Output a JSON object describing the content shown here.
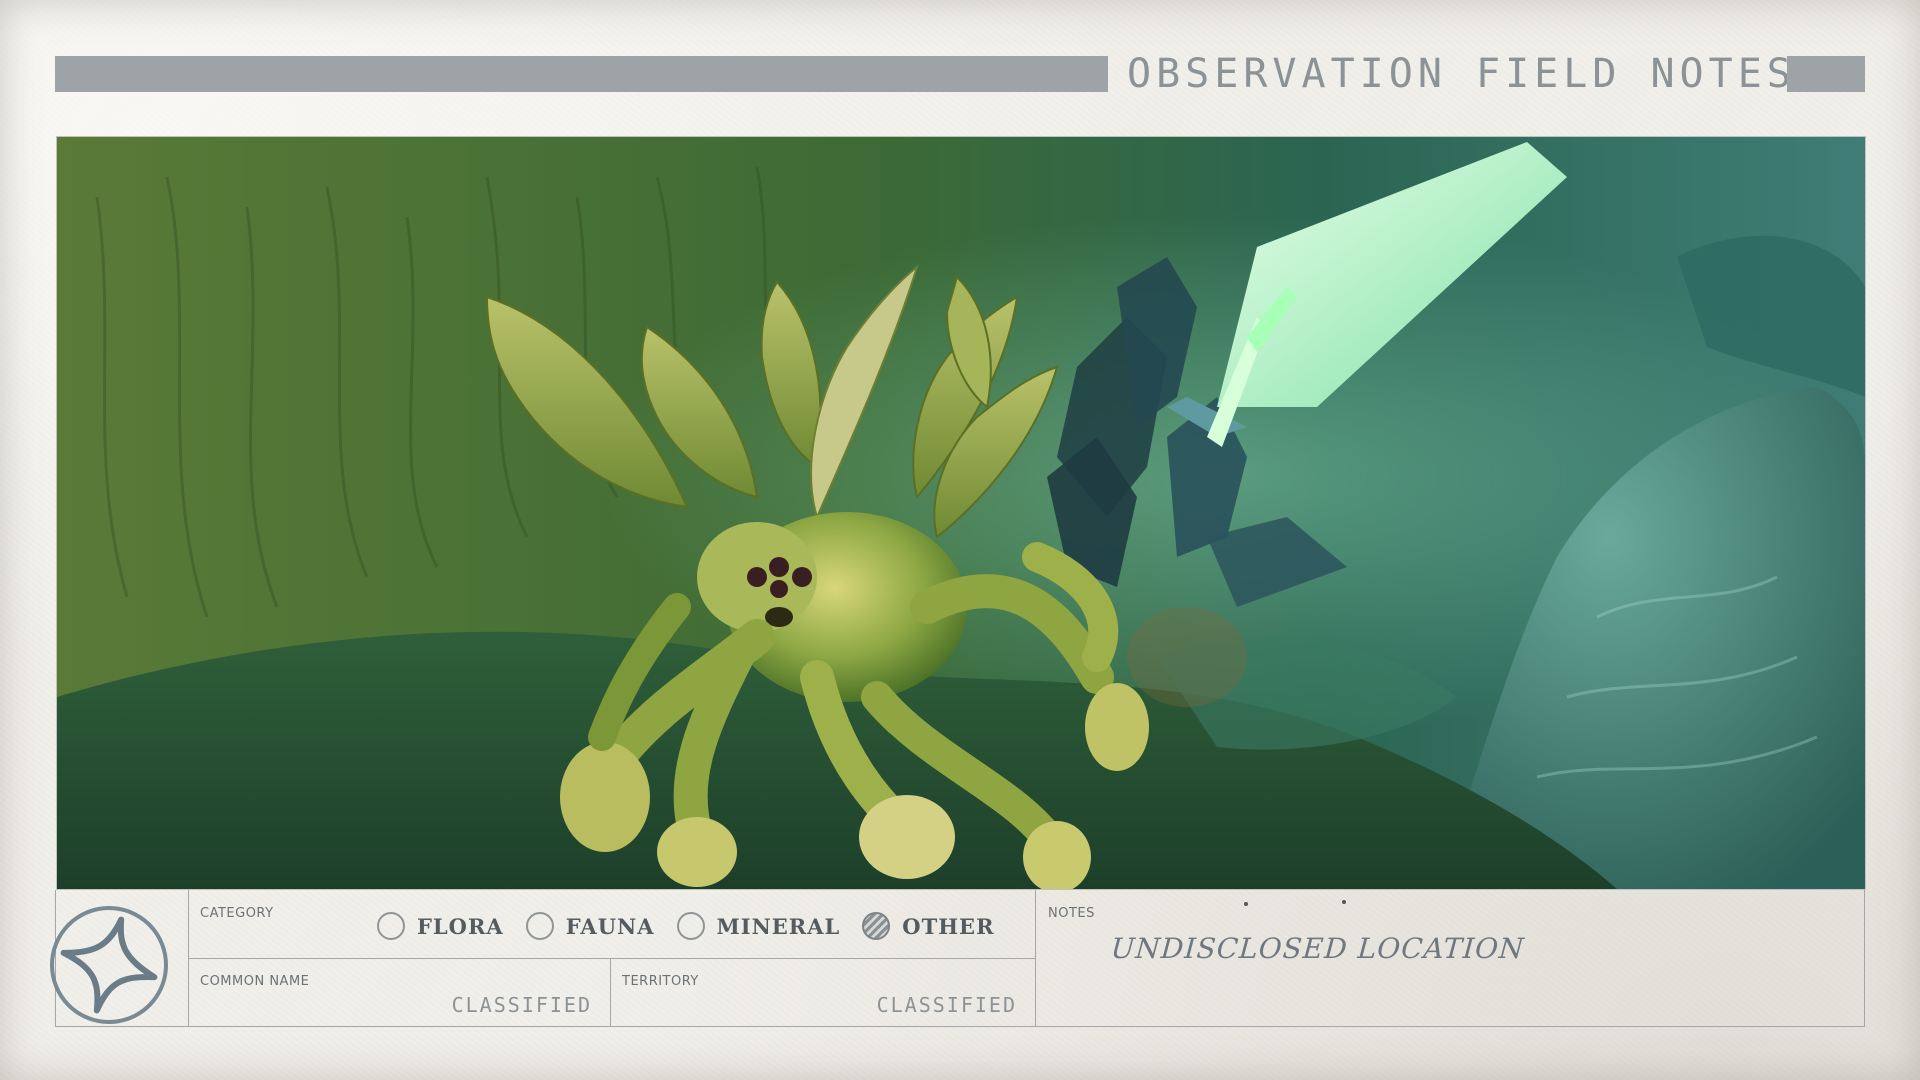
{
  "header": {
    "title": "OBSERVATION FIELD NOTES"
  },
  "photo": {
    "subject_icon": "winged-creature-illustration"
  },
  "panel": {
    "logo_icon": "four-point-star-emblem-icon",
    "category_label": "CATEGORY",
    "options": [
      {
        "label": "FLORA",
        "selected": false
      },
      {
        "label": "FAUNA",
        "selected": false
      },
      {
        "label": "MINERAL",
        "selected": false
      },
      {
        "label": "OTHER",
        "selected": true
      }
    ],
    "common_name_label": "COMMON NAME",
    "common_name_value": "CLASSIFIED",
    "territory_label": "TERRITORY",
    "territory_value": "CLASSIFIED",
    "notes_label": "NOTES",
    "notes_value": "UNDISCLOSED LOCATION"
  },
  "colors": {
    "card": "#f1efe9",
    "bar": "#9da3a6",
    "ink": "#545c60",
    "scene_green": "#3f7a3a",
    "crystal": "#b9f4c8"
  }
}
